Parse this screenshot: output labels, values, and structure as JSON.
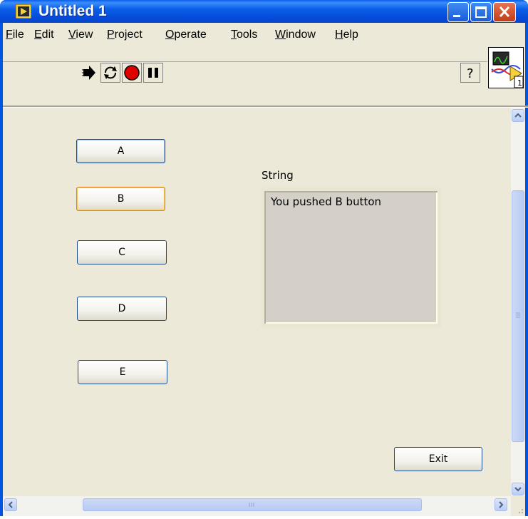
{
  "window": {
    "title": "Untitled 1"
  },
  "menu": {
    "items": [
      {
        "underline": "F",
        "rest": "ile"
      },
      {
        "underline": "E",
        "rest": "dit"
      },
      {
        "underline": "V",
        "rest": "iew"
      },
      {
        "underline": "P",
        "rest": "roject"
      },
      {
        "underline": "O",
        "rest": "perate"
      },
      {
        "underline": "T",
        "rest": "ools"
      },
      {
        "underline": "W",
        "rest": "indow"
      },
      {
        "underline": "H",
        "rest": "elp"
      }
    ]
  },
  "toolbar": {
    "icons": [
      "run-arrow-icon",
      "run-continuously-icon",
      "abort-icon",
      "pause-icon",
      "context-help-icon"
    ],
    "vi_icon_number": "1"
  },
  "panel": {
    "buttons": [
      "A",
      "B",
      "C",
      "D",
      "E"
    ],
    "string_label": "String",
    "string_value": "You pushed B button",
    "exit_label": "Exit"
  },
  "colors": {
    "titlebar": "#0a5fe8",
    "panel_bg": "#ece9d8",
    "highlight": "#d98a1a",
    "abort": "#e00000"
  }
}
